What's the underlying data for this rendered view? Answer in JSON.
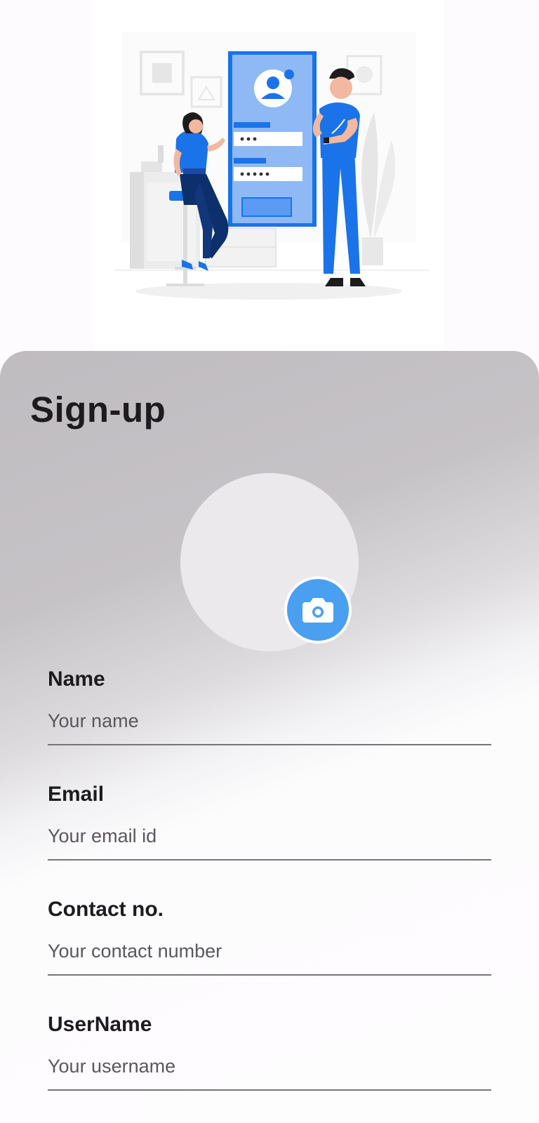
{
  "form": {
    "title": "Sign-up",
    "camera_icon": "camera-icon",
    "fields": [
      {
        "label": "Name",
        "placeholder": "Your name",
        "value": ""
      },
      {
        "label": "Email",
        "placeholder": "Your email id",
        "value": ""
      },
      {
        "label": "Contact no.",
        "placeholder": "Your contact number",
        "value": ""
      },
      {
        "label": "UserName",
        "placeholder": "Your username",
        "value": ""
      }
    ]
  },
  "colors": {
    "accent": "#4a9ff0",
    "illustration_blue": "#1a73e8",
    "title_text": "#1c1b1e"
  }
}
